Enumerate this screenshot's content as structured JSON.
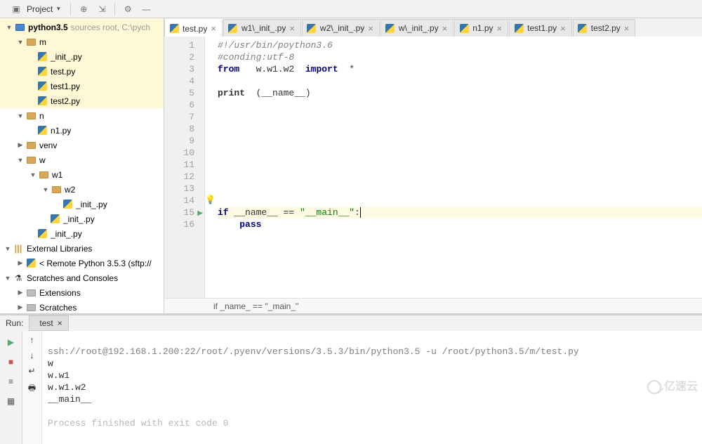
{
  "toolbar": {
    "project_label": "Project"
  },
  "tabs": [
    {
      "label": "test.py",
      "active": true
    },
    {
      "label": "w1\\_init_.py",
      "active": false
    },
    {
      "label": "w2\\_init_.py",
      "active": false
    },
    {
      "label": "w\\_init_.py",
      "active": false
    },
    {
      "label": "n1.py",
      "active": false
    },
    {
      "label": "test1.py",
      "active": false
    },
    {
      "label": "test2.py",
      "active": false
    }
  ],
  "tree": {
    "root": {
      "name": "python3.5",
      "hint": "sources root, C:\\pych"
    },
    "m": {
      "name": "m",
      "files": [
        "_init_.py",
        "test.py",
        "test1.py",
        "test2.py"
      ]
    },
    "n": {
      "name": "n",
      "files": [
        "n1.py"
      ]
    },
    "venv": {
      "name": "venv"
    },
    "w": {
      "name": "w"
    },
    "w1": {
      "name": "w1"
    },
    "w2": {
      "name": "w2",
      "files": [
        "_init_.py"
      ]
    },
    "w1_files": [
      "_init_.py"
    ],
    "w_files": [
      "_init_.py"
    ],
    "ext_lib": "External Libraries",
    "remote": "< Remote Python 3.5.3 (sftp://",
    "scratches": "Scratches and Consoles",
    "extensions": "Extensions",
    "scratches2": "Scratches"
  },
  "code": {
    "l1": "#!/usr/bin/poython3.6",
    "l2": "#conding:utf-8",
    "l3a": "from",
    "l3b": "w.w1.w2",
    "l3c": "import",
    "l3d": "*",
    "l5a": "print",
    "l5b": "(__name__)",
    "l15a": "if",
    "l15b": " __name__ == ",
    "l15c": "\"__main__\"",
    "l15d": ":",
    "l16": "pass"
  },
  "crumb": "if _name_ == \"_main_\"",
  "run": {
    "title": "Run:",
    "tab": "test",
    "cmd": "ssh://root@192.168.1.200:22/root/.pyenv/versions/3.5.3/bin/python3.5 -u /root/python3.5/m/test.py",
    "out1": "w",
    "out2": "w.w1",
    "out3": "w.w1.w2",
    "out4": "__main__",
    "exit": "Process finished with exit code 0"
  },
  "watermark": "亿速云"
}
